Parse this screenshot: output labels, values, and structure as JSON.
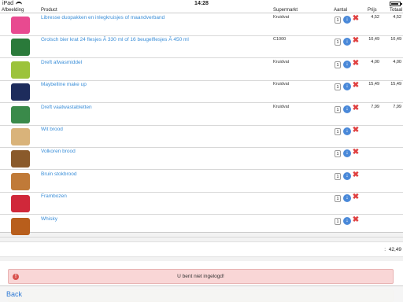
{
  "status": {
    "device": "iPad",
    "time": "14:28"
  },
  "table": {
    "headers": {
      "image": "Afbeelding",
      "product": "Product",
      "store": "Supermarkt",
      "quantity": "Aantal",
      "price": "Prijs",
      "total": "Totaal"
    },
    "rows": [
      {
        "product": "Libresse duopakken en inlegkruisjes of maandverband",
        "store": "Kruidvat",
        "qty": "1",
        "price": "4,52",
        "total": "4,52",
        "thumb_color": "#e84a90",
        "thumb_icon": "pad-pack-icon"
      },
      {
        "product": "Grolsch bier krat 24 flesjes Ã  330 ml of 16 beugelflesjes Ã  450 ml",
        "store": "C1000",
        "qty": "1",
        "price": "10,49",
        "total": "10,49",
        "thumb_color": "#2a7a3a",
        "thumb_icon": "beer-crate-icon"
      },
      {
        "product": "Dreft afwasmiddel",
        "store": "Kruidvat",
        "qty": "1",
        "price": "4,00",
        "total": "4,00",
        "thumb_color": "#9cc33b",
        "thumb_icon": "detergent-bottle-icon"
      },
      {
        "product": "Maybelline make up",
        "store": "Kruidvat",
        "qty": "1",
        "price": "15,49",
        "total": "15,49",
        "thumb_color": "#1d2c5c",
        "thumb_icon": "makeup-icon"
      },
      {
        "product": "Dreft vaatwastabletten",
        "store": "Kruidvat",
        "qty": "1",
        "price": "7,99",
        "total": "7,99",
        "thumb_color": "#3a8a4a",
        "thumb_icon": "dishwasher-tablets-icon"
      },
      {
        "product": "Wit brood",
        "store": "",
        "qty": "1",
        "price": "",
        "total": "",
        "thumb_color": "#d9b37a",
        "thumb_icon": "white-bread-icon"
      },
      {
        "product": "Volkoren brood",
        "store": "",
        "qty": "1",
        "price": "",
        "total": "",
        "thumb_color": "#8a5a2b",
        "thumb_icon": "wholegrain-bread-icon"
      },
      {
        "product": "Bruin stokbrood",
        "store": "",
        "qty": "1",
        "price": "",
        "total": "",
        "thumb_color": "#c07a38",
        "thumb_icon": "baguette-icon"
      },
      {
        "product": "Frambozen",
        "store": "",
        "qty": "1",
        "price": "",
        "total": "",
        "thumb_color": "#d0283a",
        "thumb_icon": "raspberries-icon"
      },
      {
        "product": "Whisky",
        "store": "",
        "qty": "1",
        "price": "",
        "total": "",
        "thumb_color": "#b85e1c",
        "thumb_icon": "whisky-bottle-icon"
      }
    ]
  },
  "summary": {
    "colon": ":",
    "amount": "42,49"
  },
  "alert": {
    "icon": "!",
    "message": "U bent niet ingelogd!"
  },
  "nav": {
    "back_label": "Back"
  }
}
